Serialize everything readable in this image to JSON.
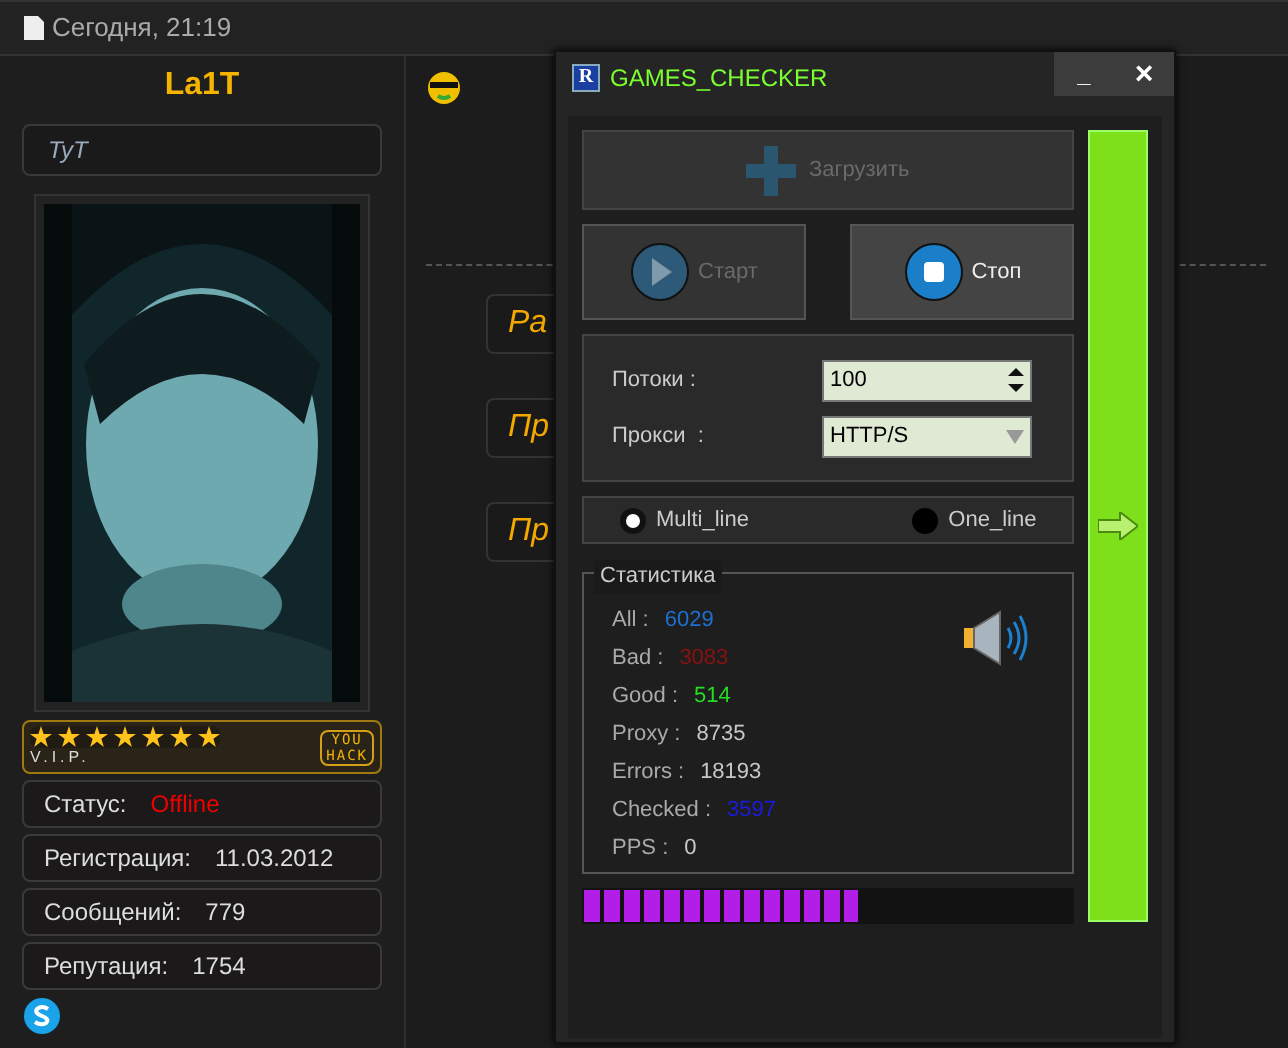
{
  "post_header": {
    "date": "Сегодня, 21:19"
  },
  "user": {
    "name": "La1T",
    "title": "TyT",
    "rank": {
      "stars": 7,
      "label": "V.I.P.",
      "badge": [
        "YOU",
        "HACK"
      ]
    },
    "info": [
      {
        "label": "Статус:",
        "value": "Offline",
        "kind": "status"
      },
      {
        "label": "Регистрация:",
        "value": "11.03.2012",
        "kind": "plain"
      },
      {
        "label": "Сообщений:",
        "value": "779",
        "kind": "plain"
      },
      {
        "label": "Репутация:",
        "value": "1754",
        "kind": "plain"
      }
    ]
  },
  "post": {
    "tags": [
      "Ра",
      "Пр",
      "Пр"
    ]
  },
  "window": {
    "icon": "R",
    "title": "GAMES_CHECKER",
    "minimize": "_",
    "close": "×",
    "load_button": {
      "label": "Загрузить",
      "disabled": true
    },
    "start_button": {
      "label": "Старт",
      "disabled": true
    },
    "stop_button": {
      "label": "Стоп",
      "disabled": false
    },
    "threads": {
      "label": "Потоки :",
      "value": "100"
    },
    "proxy": {
      "label": "Прокси  :",
      "value": "HTTP/S"
    },
    "modes": [
      {
        "label": "Multi_line",
        "selected": true
      },
      {
        "label": "One_line",
        "selected": false
      }
    ],
    "stats": {
      "title": "Статистика",
      "rows": [
        {
          "label": "All :",
          "value": "6029",
          "color": "#1e6fd0"
        },
        {
          "label": "Bad :",
          "value": "3083",
          "color": "#8b1010"
        },
        {
          "label": "Good :",
          "value": "514",
          "color": "#22dd22"
        },
        {
          "label": "Proxy :",
          "value": "8735",
          "color": "#c8c8c8"
        },
        {
          "label": "Errors :",
          "value": "18193",
          "color": "#c8c8c8"
        },
        {
          "label": "Checked :",
          "value": "3597",
          "color": "#1a1ae0"
        },
        {
          "label": "PPS :",
          "value": "0",
          "color": "#c8c8c8"
        }
      ]
    },
    "progress": {
      "level": 0.56
    }
  }
}
